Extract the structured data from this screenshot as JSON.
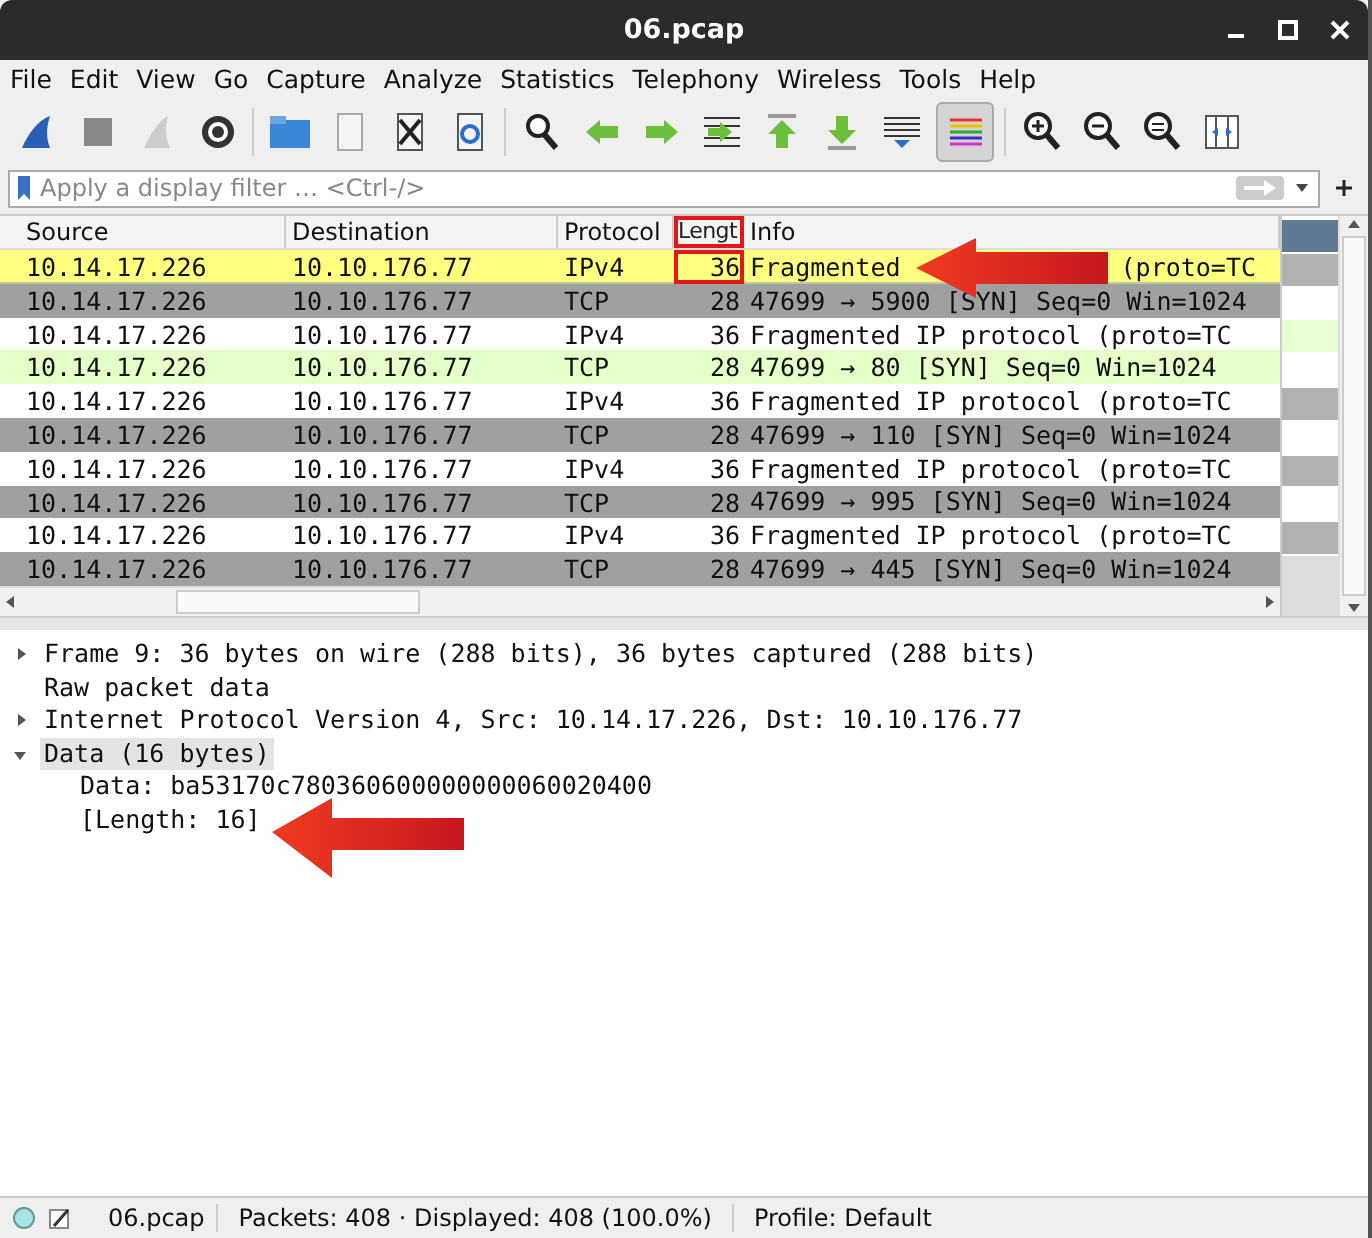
{
  "window": {
    "title": "06.pcap"
  },
  "menu": [
    "File",
    "Edit",
    "View",
    "Go",
    "Capture",
    "Analyze",
    "Statistics",
    "Telephony",
    "Wireless",
    "Tools",
    "Help"
  ],
  "filter": {
    "placeholder": "Apply a display filter … <Ctrl-/>"
  },
  "packet_list": {
    "columns": [
      {
        "label": "Source",
        "highlighted": false
      },
      {
        "label": "Destination",
        "highlighted": false
      },
      {
        "label": "Protocol",
        "highlighted": false
      },
      {
        "label": "Lengt",
        "highlighted": true
      },
      {
        "label": "Info",
        "highlighted": false
      }
    ],
    "rows": [
      {
        "source": "10.14.17.226",
        "destination": "10.10.176.77",
        "protocol": "IPv4",
        "length": "36",
        "info": "Fragmented",
        "info_tail": "(proto=TC",
        "color": "#ffff80",
        "selected": true,
        "arrow": true
      },
      {
        "source": "10.14.17.226",
        "destination": "10.10.176.77",
        "protocol": "TCP",
        "length": "28",
        "info": "47699 → 5900 [SYN] Seq=0 Win=1024",
        "color": "#a0a0a0",
        "selected": false,
        "arrow": false
      },
      {
        "source": "10.14.17.226",
        "destination": "10.10.176.77",
        "protocol": "IPv4",
        "length": "36",
        "info": "Fragmented IP protocol (proto=TC",
        "color": "#ffffff",
        "selected": false,
        "arrow": false
      },
      {
        "source": "10.14.17.226",
        "destination": "10.10.176.77",
        "protocol": "TCP",
        "length": "28",
        "info": "47699 → 80 [SYN] Seq=0 Win=1024",
        "color": "#e4ffc7",
        "selected": false,
        "arrow": false
      },
      {
        "source": "10.14.17.226",
        "destination": "10.10.176.77",
        "protocol": "IPv4",
        "length": "36",
        "info": "Fragmented IP protocol (proto=TC",
        "color": "#ffffff",
        "selected": false,
        "arrow": false
      },
      {
        "source": "10.14.17.226",
        "destination": "10.10.176.77",
        "protocol": "TCP",
        "length": "28",
        "info": "47699 → 110 [SYN] Seq=0 Win=1024",
        "color": "#a0a0a0",
        "selected": false,
        "arrow": false
      },
      {
        "source": "10.14.17.226",
        "destination": "10.10.176.77",
        "protocol": "IPv4",
        "length": "36",
        "info": "Fragmented IP protocol (proto=TC",
        "color": "#ffffff",
        "selected": false,
        "arrow": false
      },
      {
        "source": "10.14.17.226",
        "destination": "10.10.176.77",
        "protocol": "TCP",
        "length": "28",
        "info": "47699 → 995 [SYN] Seq=0 Win=1024",
        "color": "#a0a0a0",
        "selected": false,
        "arrow": false
      },
      {
        "source": "10.14.17.226",
        "destination": "10.10.176.77",
        "protocol": "IPv4",
        "length": "36",
        "info": "Fragmented IP protocol (proto=TC",
        "color": "#ffffff",
        "selected": false,
        "arrow": false
      },
      {
        "source": "10.14.17.226",
        "destination": "10.10.176.77",
        "protocol": "TCP",
        "length": "28",
        "info": "47699 → 445 [SYN] Seq=0 Win=1024",
        "color": "#a0a0a0",
        "selected": false,
        "arrow": false
      }
    ]
  },
  "details": [
    {
      "text": "Frame 9: 36 bytes on wire (288 bits), 36 bytes captured (288 bits)",
      "expandable": true,
      "expanded": false,
      "selected": false
    },
    {
      "text": "Raw packet data",
      "expandable": false,
      "selected": false
    },
    {
      "text": "Internet Protocol Version 4, Src: 10.14.17.226, Dst: 10.10.176.77",
      "expandable": true,
      "expanded": false,
      "selected": false
    },
    {
      "text": "Data (16 bytes)",
      "expandable": true,
      "expanded": true,
      "selected": true,
      "children": [
        {
          "text": "Data: ba53170c780360600000000060020400",
          "arrow": false
        },
        {
          "text": "[Length: 16]",
          "arrow": true
        }
      ]
    }
  ],
  "status_bar": {
    "file": "06.pcap",
    "packets": "Packets: 408 · Displayed: 408 (100.0%)",
    "profile": "Profile: Default"
  }
}
